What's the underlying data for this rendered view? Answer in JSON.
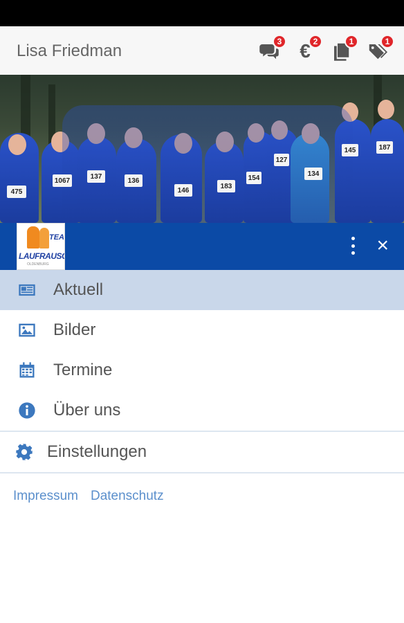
{
  "header": {
    "user_name": "Lisa Friedman",
    "icons": [
      {
        "name": "chat-icon",
        "badge": "3"
      },
      {
        "name": "euro-icon",
        "glyph": "€",
        "badge": "2"
      },
      {
        "name": "documents-icon",
        "badge": "1"
      },
      {
        "name": "tags-icon",
        "badge": "1"
      }
    ]
  },
  "photo": {
    "bibs": [
      "475",
      "1067",
      "137",
      "136",
      "146",
      "183",
      "154",
      "127",
      "134",
      "145",
      "187"
    ]
  },
  "drawer": {
    "logo": {
      "line1": "TEAM",
      "line2": "LAUFRAUSCH",
      "line3": "OLDENBURG"
    },
    "close_label": "×"
  },
  "menu": {
    "items": [
      {
        "label": "Aktuell",
        "icon": "newspaper-icon",
        "active": true
      },
      {
        "label": "Bilder",
        "icon": "image-icon",
        "active": false
      },
      {
        "label": "Termine",
        "icon": "calendar-icon",
        "active": false
      },
      {
        "label": "Über uns",
        "icon": "info-icon",
        "active": false
      }
    ],
    "settings": {
      "label": "Einstellungen",
      "icon": "gear-icon"
    }
  },
  "footer": {
    "impressum": "Impressum",
    "datenschutz": "Datenschutz"
  },
  "colors": {
    "accent": "#0b4aa6",
    "active_row": "#c9d7ea",
    "icon_blue": "#3c78be",
    "badge_red": "#e0262a",
    "link": "#5b8fcc"
  }
}
